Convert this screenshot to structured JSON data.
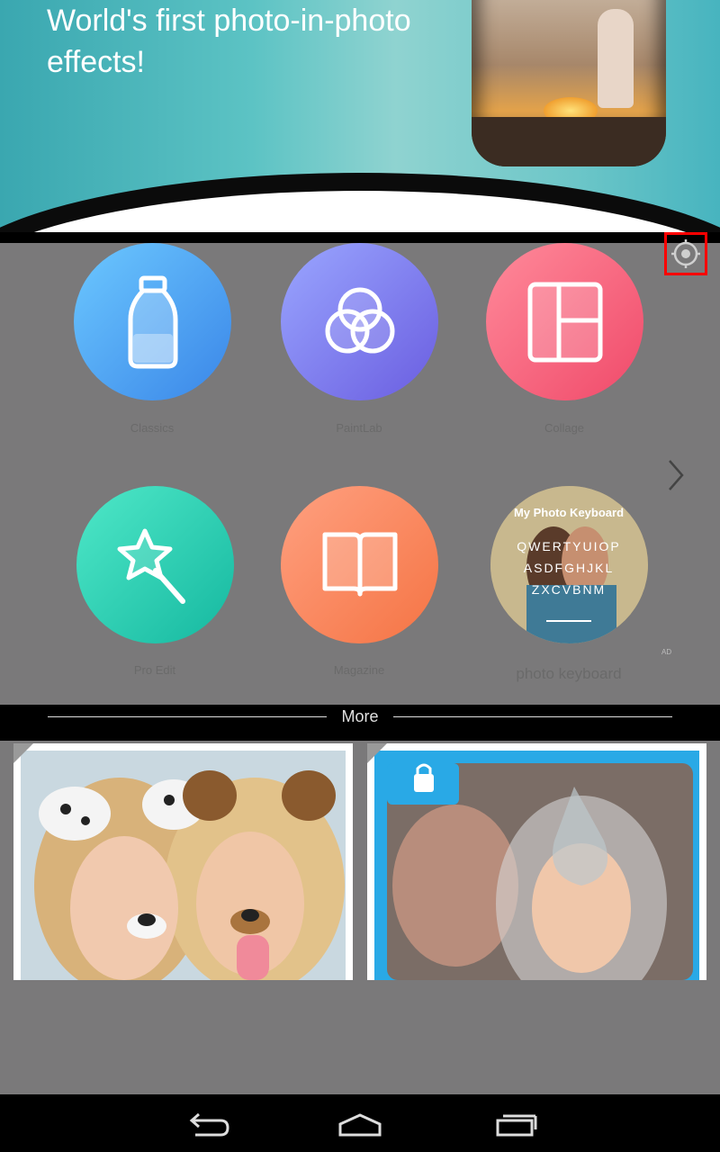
{
  "banner": {
    "headline": "World's first photo-in-photo\neffects!"
  },
  "apps": [
    {
      "label": "Classics",
      "icon": "bottle-icon",
      "color_start": "#6cc8ff",
      "color_end": "#3a86e8"
    },
    {
      "label": "PaintLab",
      "icon": "triple-circles-icon",
      "color_start": "#9aa6ff",
      "color_end": "#6a5de0"
    },
    {
      "label": "Collage",
      "icon": "collage-grid-icon",
      "color_start": "#ff8a9a",
      "color_end": "#f04a6a"
    },
    {
      "label": "Pro Edit",
      "icon": "magic-wand-icon",
      "color_start": "#4fe8c8",
      "color_end": "#15b8a0"
    },
    {
      "label": "Magazine",
      "icon": "open-book-icon",
      "color_start": "#ffa080",
      "color_end": "#f57444"
    },
    {
      "label": "photo keyboard",
      "icon": "keyboard-photo",
      "ad": "AD"
    }
  ],
  "keyboard_ad": {
    "title": "My Photo Keyboard",
    "rows": [
      "QWERTYUIOP",
      "ASDFGHJKL",
      "ZXCVBNM"
    ]
  },
  "more": {
    "label": "More"
  },
  "settings": {
    "icon": "settings-icon"
  }
}
